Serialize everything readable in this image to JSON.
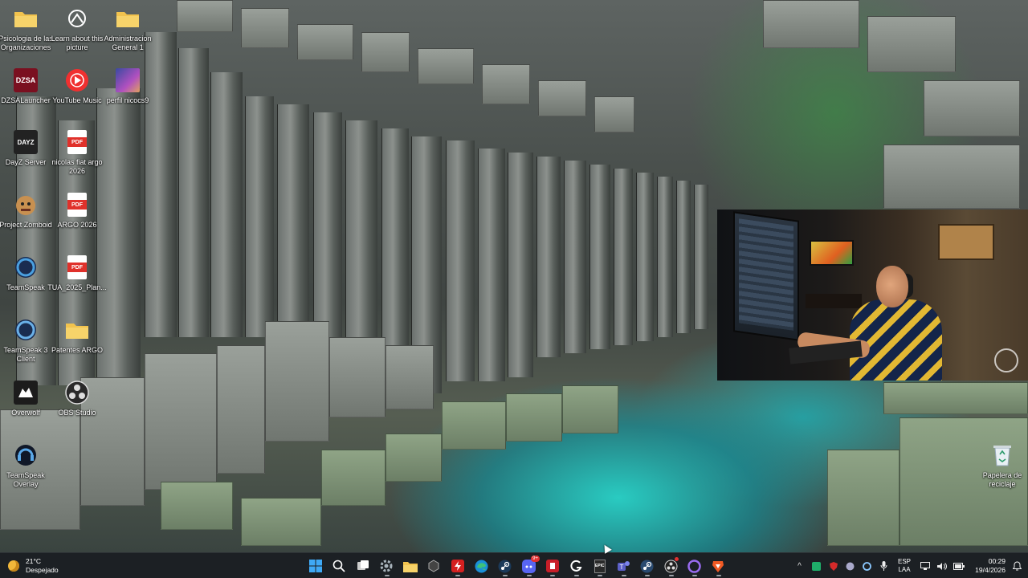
{
  "desktop": {
    "icons": [
      {
        "label": "Psicologia de las Organizaciones",
        "icon": "folder-icon"
      },
      {
        "label": "Learn about this picture",
        "icon": "camera-icon"
      },
      {
        "label": "Administracion General 1",
        "icon": "folder-icon"
      },
      {
        "label": "DZSALauncher",
        "icon": "dzsa-launcher-icon"
      },
      {
        "label": "YouTube Music",
        "icon": "youtube-music-icon"
      },
      {
        "label": "perfil nicocs9",
        "icon": "profile-image-icon"
      },
      {
        "label": "DayZ Server",
        "icon": "dayz-icon"
      },
      {
        "label": "nicolas fiat argo 2026",
        "icon": "pdf-icon"
      },
      {
        "label": "Project Zomboid",
        "icon": "project-zomboid-icon"
      },
      {
        "label": "ARGO 2026",
        "icon": "pdf-icon"
      },
      {
        "label": "TeamSpeak",
        "icon": "teamspeak-icon"
      },
      {
        "label": "TUA_2025_Plan...",
        "icon": "pdf-icon"
      },
      {
        "label": "TeamSpeak 3 Client",
        "icon": "teamspeak-icon"
      },
      {
        "label": "Patentes ARGO",
        "icon": "folder-icon"
      },
      {
        "label": "Overwolf",
        "icon": "overwolf-icon"
      },
      {
        "label": "OBS Studio",
        "icon": "obs-icon"
      },
      {
        "label": "TeamSpeak Overlay",
        "icon": "teamspeak-overlay-icon"
      },
      {
        "label": "Papelera de reciclaje",
        "icon": "recycle-bin-icon"
      }
    ],
    "pdf_badge": "PDF",
    "dzsa_badge": "DZSA",
    "dayz_badge": "DAYZ"
  },
  "webcam": {
    "label": "webcam-overlay"
  },
  "taskbar": {
    "weather_temp": "21°C",
    "weather_desc": "Despejado",
    "apps": [
      {
        "icon": "windows-start-icon"
      },
      {
        "icon": "search-icon"
      },
      {
        "icon": "task-view-icon"
      },
      {
        "icon": "settings-icon"
      },
      {
        "icon": "file-explorer-icon"
      },
      {
        "icon": "cube-app-icon"
      },
      {
        "icon": "red-bolt-app-icon"
      },
      {
        "icon": "edge-icon"
      },
      {
        "icon": "steam-icon"
      },
      {
        "icon": "discord-icon"
      },
      {
        "icon": "red-app-icon"
      },
      {
        "icon": "g-app-icon"
      },
      {
        "icon": "epic-games-icon"
      },
      {
        "icon": "teams-icon"
      },
      {
        "icon": "steam-icon"
      },
      {
        "icon": "obs-icon"
      },
      {
        "icon": "purple-ring-app-icon"
      },
      {
        "icon": "brave-icon"
      }
    ],
    "discord_badge": "9+",
    "epic_label": "EPIC",
    "tray": {
      "chevron": "^",
      "lang_line1": "ESP",
      "lang_line2": "LAA",
      "time": "00:29",
      "date": "19/4/2026"
    }
  },
  "colors": {
    "folder": "#f2c34e",
    "pdf": "#e0312b",
    "taskbar": "#1c2024",
    "accent_water": "#28d2c8"
  }
}
